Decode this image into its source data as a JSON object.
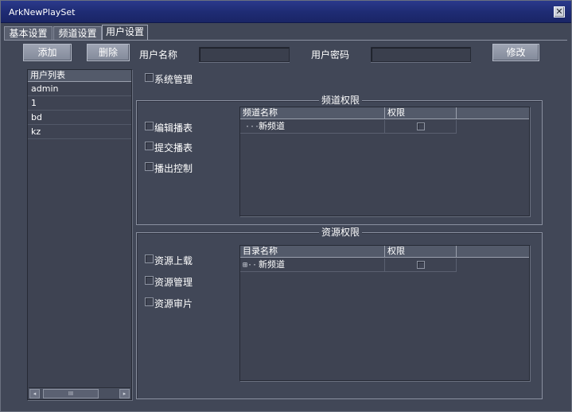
{
  "window": {
    "title": "ArkNewPlaySet",
    "close_glyph": "✕"
  },
  "tabs": [
    {
      "label": "基本设置",
      "active": false
    },
    {
      "label": "频道设置",
      "active": false
    },
    {
      "label": "用户设置",
      "active": true
    }
  ],
  "toolbar": {
    "add_label": "添加",
    "delete_label": "删除",
    "username_label": "用户名称",
    "username_value": "",
    "password_label": "用户密码",
    "password_value": "",
    "modify_label": "修改"
  },
  "user_list": {
    "header": "用户列表",
    "items": [
      "admin",
      "1",
      "bd",
      "kz"
    ],
    "scroll_left": "◂",
    "scroll_thumb": "III",
    "scroll_right": "▸"
  },
  "system_admin": {
    "label": "系统管理",
    "checked": false
  },
  "channel_perms": {
    "title": "频道权限",
    "checkboxes": [
      {
        "label": "编辑播表",
        "checked": false
      },
      {
        "label": "提交播表",
        "checked": false
      },
      {
        "label": "播出控制",
        "checked": false
      }
    ],
    "columns": [
      "频道名称",
      "权限",
      ""
    ],
    "rows": [
      {
        "prefix": "·····",
        "name": "新频道",
        "permitted": false
      }
    ]
  },
  "resource_perms": {
    "title": "资源权限",
    "checkboxes": [
      {
        "label": "资源上载",
        "checked": false
      },
      {
        "label": "资源管理",
        "checked": false
      },
      {
        "label": "资源审片",
        "checked": false
      }
    ],
    "columns": [
      "目录名称",
      "权限",
      ""
    ],
    "rows": [
      {
        "prefix": "⊞··",
        "name": "新频道",
        "permitted": false
      }
    ]
  },
  "colors": {
    "titlebar": "#1f2c74",
    "panel": "#414757",
    "field": "#3e4352",
    "button": "#8f96a6"
  }
}
